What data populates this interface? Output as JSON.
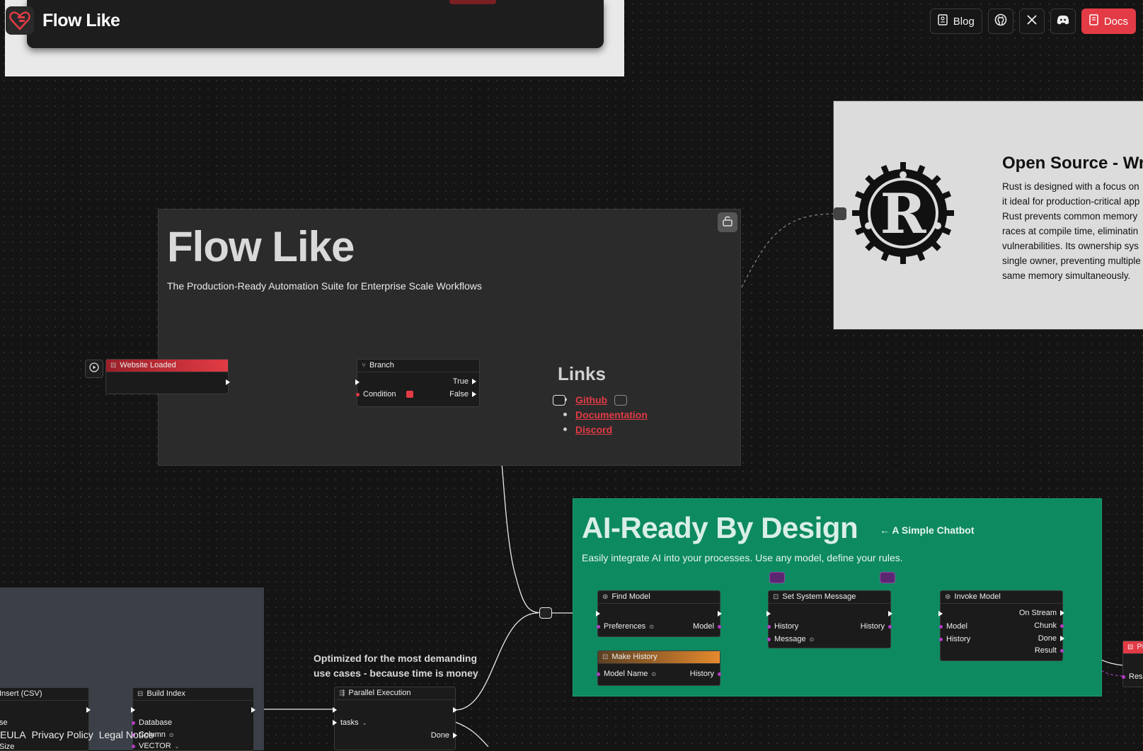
{
  "header": {
    "brand_name": "Flow Like",
    "nav": {
      "blog_label": "Blog",
      "docs_label": "Docs"
    },
    "icons": [
      "flow-like-logo-icon",
      "blog-icon",
      "github-icon",
      "x-icon",
      "discord-icon",
      "docs-icon"
    ],
    "accent_color": "#e23b45"
  },
  "rust_card": {
    "title": "Open Source - Writ",
    "body_lines": [
      "Rust is designed with a focus on",
      "it ideal for production-critical app",
      "Rust prevents common memory",
      "races at compile time, eliminatin",
      "vulnerabilities. Its ownership sys",
      "single owner, preventing multiple",
      "same memory simultaneously."
    ],
    "logo_letter": "R"
  },
  "hero": {
    "title": "Flow Like",
    "subtitle": "The Production-Ready Automation Suite for Enterprise Scale Workflows",
    "links_title": "Links",
    "links": [
      "Github",
      "Documentation",
      "Discord"
    ]
  },
  "nodes": {
    "website_loaded": {
      "title": "Website Loaded"
    },
    "branch": {
      "title": "Branch",
      "true_label": "True",
      "false_label": "False",
      "condition_label": "Condition"
    },
    "find_model": {
      "title": "Find Model",
      "preferences": "Preferences",
      "model": "Model"
    },
    "make_history": {
      "title": "Make History",
      "model_name": "Model Name",
      "history": "History"
    },
    "set_system_message": {
      "title": "Set System Message",
      "history_in": "History",
      "history_out": "History",
      "message": "Message"
    },
    "invoke_model": {
      "title": "Invoke Model",
      "on_stream": "On Stream",
      "chunk": "Chunk",
      "done": "Done",
      "result": "Result",
      "model": "Model",
      "history": "History"
    },
    "push_partial": {
      "title": "Pu",
      "resp": "Resp"
    },
    "insert_csv": {
      "title": "Insert (CSV)",
      "se": "se",
      "size": "Size"
    },
    "build_index": {
      "title": "Build Index",
      "database": "Database",
      "column": "Column",
      "vector": "VECTOR"
    },
    "parallel_execution": {
      "title": "Parallel Execution",
      "tasks": "tasks",
      "done": "Done"
    }
  },
  "ai_section": {
    "title": "AI-Ready By Design",
    "back_link": "← A Simple Chatbot",
    "subtitle": "Easily integrate AI into your processes. Use any model, define your rules.",
    "bg_color": "#0e8a60"
  },
  "optimized_text": {
    "line1": "Optimized for the most demanding",
    "line2": "use cases - because time is money"
  },
  "footer": {
    "links": [
      "EULA",
      "Privacy Policy",
      "Legal Notice"
    ]
  }
}
